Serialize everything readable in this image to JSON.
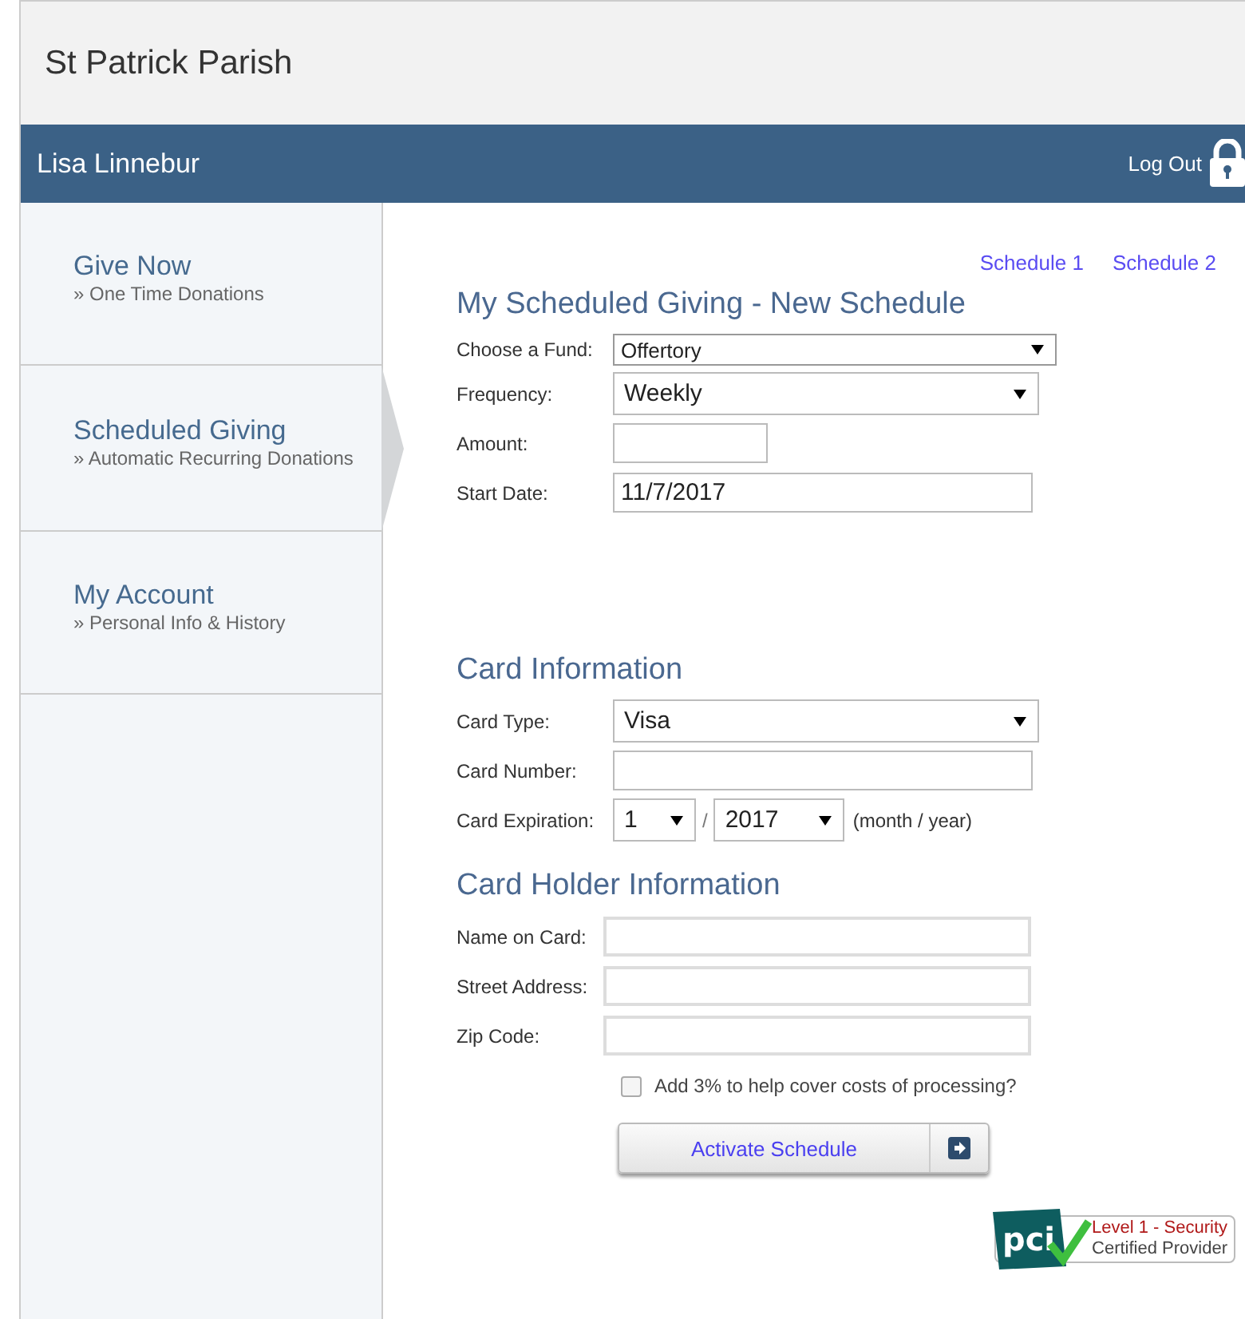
{
  "header": {
    "title": "St Patrick Parish"
  },
  "user_bar": {
    "user_name": "Lisa Linnebur",
    "logout_label": "Log Out"
  },
  "sidebar": {
    "items": [
      {
        "title": "Give Now",
        "subtitle": "» One Time Donations",
        "selected": false
      },
      {
        "title": "Scheduled Giving",
        "subtitle": "» Automatic Recurring Donations",
        "selected": true
      },
      {
        "title": "My Account",
        "subtitle": "» Personal Info & History",
        "selected": false
      }
    ]
  },
  "schedule_links": [
    "Schedule 1",
    "Schedule 2"
  ],
  "sections": [
    {
      "heading": "My Scheduled Giving - New Schedule",
      "fields": [
        {
          "label": "Choose a Fund:",
          "kind": "select",
          "value": "Offertory"
        },
        {
          "label": "Frequency:",
          "kind": "select",
          "value": "Weekly"
        },
        {
          "label": "Amount:",
          "kind": "input"
        },
        {
          "label": "Start Date:",
          "kind": "input",
          "value": "11/7/2017"
        }
      ]
    },
    {
      "heading": "Card Information",
      "fields": [
        {
          "label": "Card Type:",
          "kind": "select",
          "value": "Visa"
        },
        {
          "label": "Card Number:",
          "kind": "input"
        },
        {
          "label": "Card Expiration:",
          "kind": "expiry",
          "month": "1",
          "separator": "/",
          "year": "2017",
          "hint": "(month / year)"
        }
      ]
    },
    {
      "heading": "Card Holder Information",
      "fields": [
        {
          "label": "Name on Card:",
          "kind": "input"
        },
        {
          "label": "Street Address:",
          "kind": "input"
        },
        {
          "label": "Zip Code:",
          "kind": "input"
        }
      ]
    }
  ],
  "processing_fee": {
    "label": "Add 3% to help cover costs of processing?",
    "checked": false
  },
  "submit_button": "Activate Schedule",
  "badge": {
    "logo_text": "pci",
    "line_1": "Level 1 - Security",
    "line_2": "Certified Provider"
  }
}
